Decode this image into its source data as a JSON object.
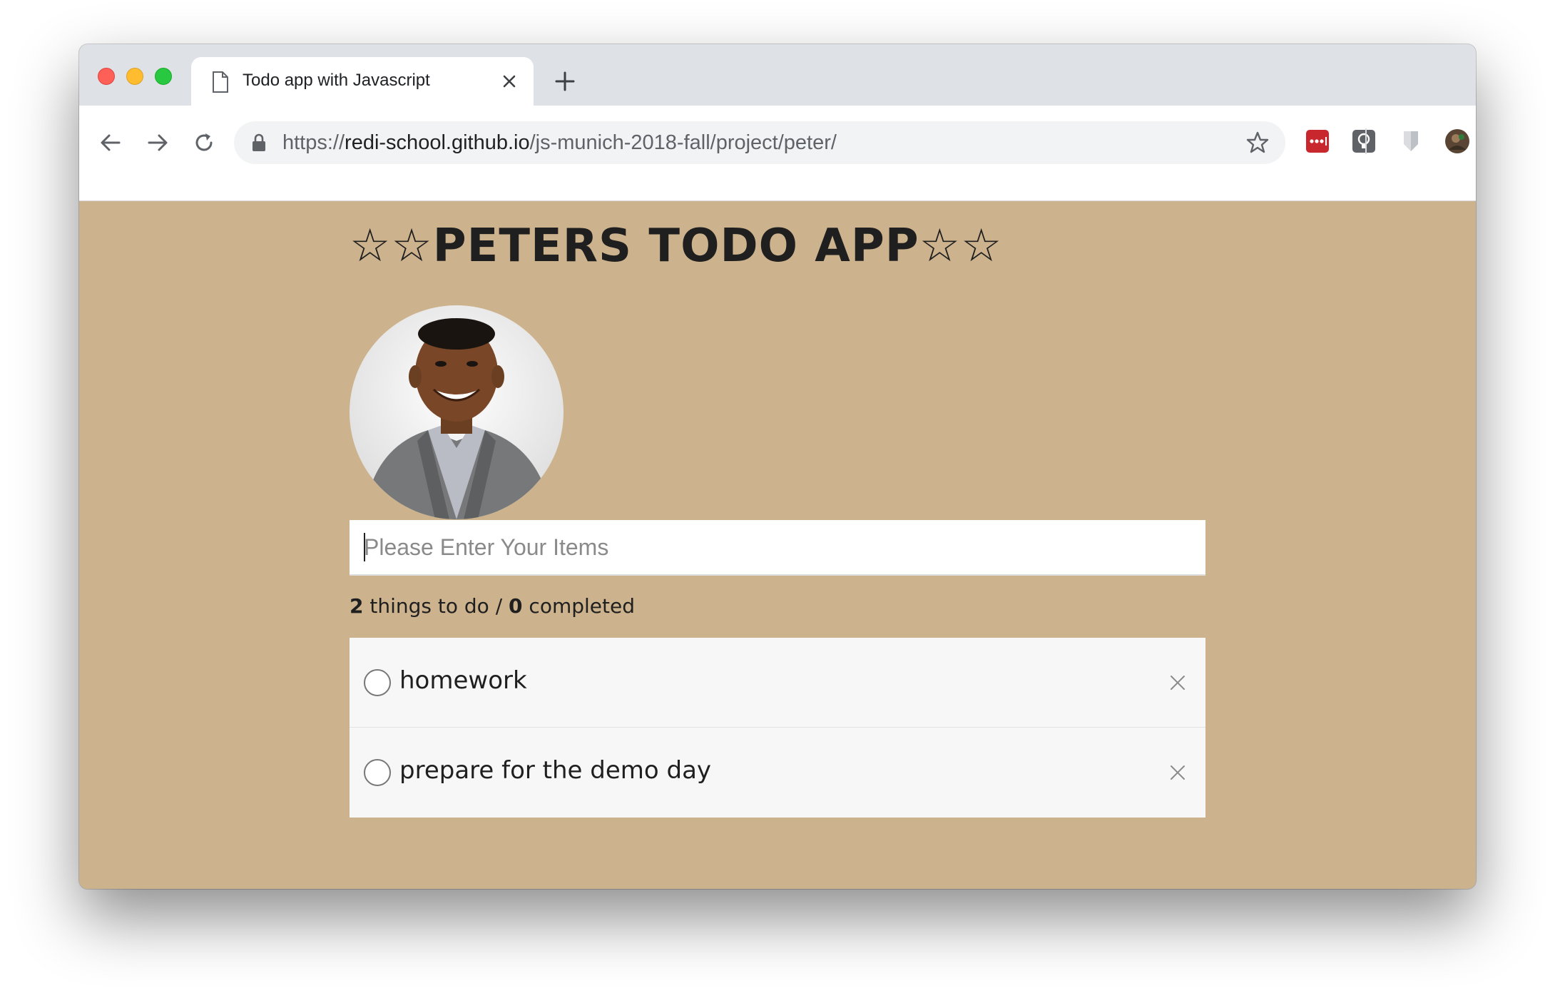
{
  "browser": {
    "tab_title": "Todo app with Javascript",
    "url_scheme": "https://",
    "url_host": "redi-school.github.io",
    "url_path": "/js-munich-2018-fall/project/peter/"
  },
  "app": {
    "title": "☆☆PETERS TODO APP☆☆",
    "input_placeholder": "Please Enter Your Items",
    "stats": {
      "todo_count": "2",
      "todo_label": " things to do / ",
      "completed_count": "0",
      "completed_label": " completed"
    },
    "items": [
      {
        "text": "homework",
        "done": false
      },
      {
        "text": "prepare for the demo day",
        "done": false
      }
    ]
  },
  "colors": {
    "page_bg": "#cdb38d",
    "tabstrip_bg": "#dee1e6",
    "item_bg": "#f7f7f7"
  }
}
